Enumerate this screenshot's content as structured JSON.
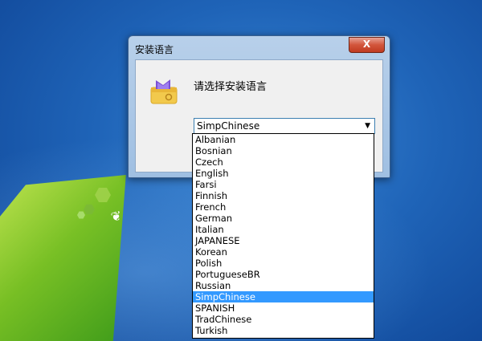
{
  "window": {
    "title": "安装语言",
    "close_label": "X",
    "prompt": "请选择安装语言",
    "combo_value": "SimpChinese"
  },
  "languages": [
    "Albanian",
    "Bosnian",
    "Czech",
    "English",
    "Farsi",
    "Finnish",
    "French",
    "German",
    "Italian",
    "JAPANESE",
    "Korean",
    "Polish",
    "PortugueseBR",
    "Russian",
    "SimpChinese",
    "SPANISH",
    "TradChinese",
    "Turkish"
  ],
  "selected_index": 14,
  "icons": {
    "app": "installer-box-icon",
    "dropdown_arrow": "chevron-down-icon",
    "desktop_logo": "windows-logo-icon",
    "butterfly": "butterfly-icon"
  },
  "colors": {
    "selection": "#3399ff",
    "close_button": "#c03a20"
  }
}
